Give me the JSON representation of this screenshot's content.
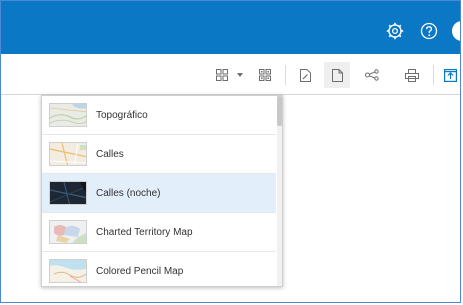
{
  "header": {
    "settings_icon": "gear-icon",
    "help_icon": "help-circle-icon",
    "accent": "#0a78c4"
  },
  "toolbar": {
    "icons": [
      "layout-grid-icon",
      "chevron-down-icon",
      "qr-grid-icon",
      "page-edit-icon",
      "page-icon",
      "share-nodes-icon",
      "print-icon",
      "export-icon"
    ]
  },
  "basemap_list": {
    "items": [
      {
        "label": "Topográfico"
      },
      {
        "label": "Calles"
      },
      {
        "label": "Calles (noche)"
      },
      {
        "label": "Charted Territory Map"
      },
      {
        "label": "Colored Pencil Map"
      }
    ],
    "selected_index": 2,
    "selected_color": "#e2eef9"
  }
}
